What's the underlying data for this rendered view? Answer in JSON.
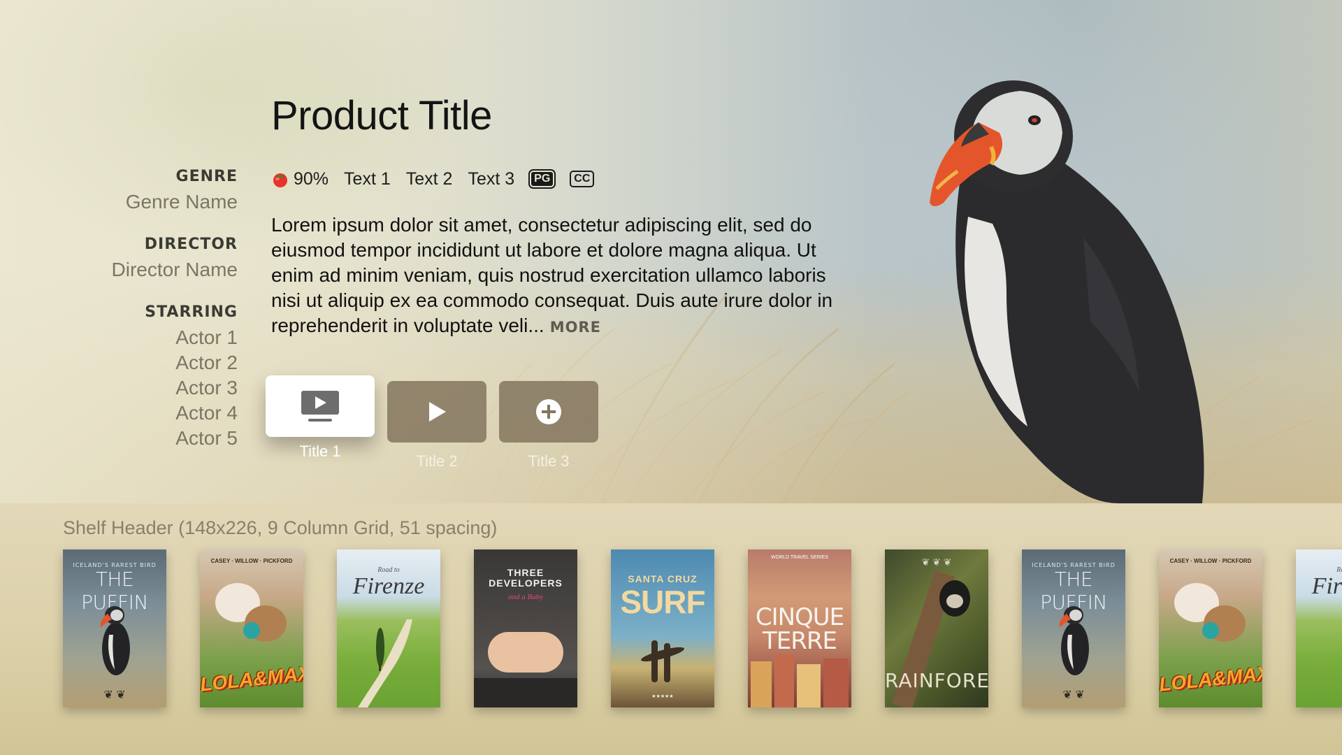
{
  "product": {
    "title": "Product Title",
    "rating_icon": "tomato-icon",
    "rating": "90%",
    "info": [
      "Text 1",
      "Text 2",
      "Text 3"
    ],
    "badges": [
      "PG",
      "CC"
    ],
    "description": "Lorem ipsum dolor sit amet, consectetur adipiscing elit, sed do eiusmod tempor incididunt ut labore et dolore magna aliqua. Ut enim ad minim veniam, quis nostrud exercitation ullamco laboris nisi ut aliquip ex ea commodo consequat. Duis aute irure dolor in reprehenderit in voluptate veli...",
    "more_label": "MORE"
  },
  "meta": {
    "genre_label": "GENRE",
    "genre": "Genre Name",
    "director_label": "DIRECTOR",
    "director": "Director Name",
    "starring_label": "STARRING",
    "actors": [
      "Actor 1",
      "Actor 2",
      "Actor 3",
      "Actor 4",
      "Actor 5"
    ]
  },
  "actions": [
    {
      "label": "Title 1",
      "icon": "tv-play-icon",
      "focused": true
    },
    {
      "label": "Title 2",
      "icon": "play-icon",
      "focused": false
    },
    {
      "label": "Title 3",
      "icon": "add-icon",
      "focused": false
    }
  ],
  "shelf": {
    "header": "Shelf Header (148x226, 9 Column Grid, 51 spacing)",
    "posters": [
      {
        "tag": "ICELAND'S RAREST BIRD",
        "title": "THE PUFFIN"
      },
      {
        "names": "CASEY · WILLOW · PICKFORD",
        "title": "LOLA&MAX"
      },
      {
        "small": "Road to",
        "title": "Firenze"
      },
      {
        "title": "THREE DEVELOPERS",
        "sub": "and a Baby"
      },
      {
        "small": "SANTA CRUZ",
        "title": "SURF",
        "caption": "★★★★★"
      },
      {
        "small": "WORLD TRAVEL SERIES",
        "title": "CINQUE TERRE"
      },
      {
        "title": "RAINFOREST"
      },
      {
        "tag": "ICELAND'S RAREST BIRD",
        "title": "THE PUFFIN"
      },
      {
        "names": "CASEY · WILLOW · PICKFORD",
        "title": "LOLA&MAX"
      },
      {
        "small": "Road to",
        "title": "Firenze"
      }
    ]
  },
  "colors": {
    "focus_button": "#ffffff",
    "button": "#84765e",
    "shelf_background": "#ddd1ab"
  }
}
